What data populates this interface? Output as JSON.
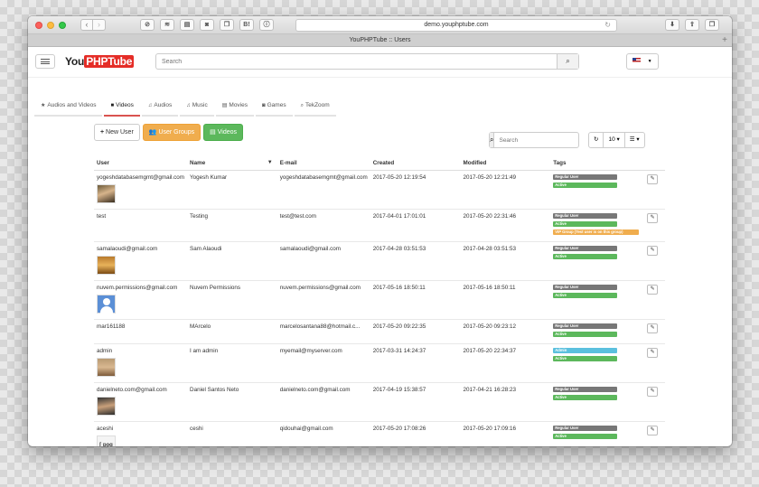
{
  "browser": {
    "url": "demo.youphptube.com",
    "tab_title": "YouPHPTube :: Users",
    "toolbar_icons": [
      "block-icon",
      "layers-icon",
      "window-icon",
      "camera-icon",
      "copy-icon",
      "bi-icon",
      "info-icon"
    ],
    "bi_label": "B!"
  },
  "header": {
    "logo_you": "You",
    "logo_php": "PHPTube",
    "search_placeholder": "Search"
  },
  "categories": [
    {
      "label": "Audios and Videos",
      "icon": "star-icon",
      "glyph": "★"
    },
    {
      "label": "Videos",
      "icon": "video-icon",
      "glyph": "■"
    },
    {
      "label": "Audios",
      "icon": "headphones-icon",
      "glyph": "♫"
    },
    {
      "label": "Music",
      "icon": "headphones-icon",
      "glyph": "♫"
    },
    {
      "label": "Movies",
      "icon": "film-icon",
      "glyph": "▤"
    },
    {
      "label": "Games",
      "icon": "gamepad-icon",
      "glyph": "◙"
    },
    {
      "label": "TekZoom",
      "icon": "zoom-icon",
      "glyph": "⌕"
    }
  ],
  "actions": {
    "new_user": "New User",
    "user_groups": "User Groups",
    "videos": "Videos"
  },
  "table_controls": {
    "search_placeholder": "Search",
    "page_size": "10"
  },
  "table": {
    "headers": [
      "User",
      "Name",
      "E-mail",
      "Created",
      "Modified",
      "Tags"
    ],
    "rows": [
      {
        "user": "yogeshdatabasemgmt@gmail.com",
        "name": "Yogesh Kumar",
        "email": "yogeshdatabasemgmt@gmail.com",
        "created": "2017-05-20 12:19:54",
        "modified": "2017-05-20 12:21:49",
        "tags": [
          "Regular User",
          "Active"
        ]
      },
      {
        "user": "test",
        "name": "Testing",
        "email": "test@test.com",
        "created": "2017-04-01 17:01:01",
        "modified": "2017-05-20 22:31:46",
        "tags": [
          "Regular User",
          "Active",
          "VIP Group (Test user is on this group)"
        ]
      },
      {
        "user": "samalaoudi@gmail.com",
        "name": "Sam Alaoudi",
        "email": "samalaoudi@gmail.com",
        "created": "2017-04-28 03:51:53",
        "modified": "2017-04-28 03:51:53",
        "tags": [
          "Regular User",
          "Active"
        ]
      },
      {
        "user": "nuvem.permissions@gmail.com",
        "name": "Nuvem Permissions",
        "email": "nuvem.permissions@gmail.com",
        "created": "2017-05-16 18:50:11",
        "modified": "2017-05-16 18:50:11",
        "tags": [
          "Regular User",
          "Active"
        ]
      },
      {
        "user": "mar161188",
        "name": "MArcelo",
        "email": "marcelosantana88@hotmail.c...",
        "created": "2017-05-20 09:22:35",
        "modified": "2017-05-20 09:23:12",
        "tags": [
          "Regular User",
          "Active"
        ]
      },
      {
        "user": "admin",
        "name": "I am admin",
        "email": "myemail@myserver.com",
        "created": "2017-03-31 14:24:37",
        "modified": "2017-05-20 22:34:37",
        "tags": [
          "Admin",
          "Active"
        ]
      },
      {
        "user": "danielneto.com@gmail.com",
        "name": "Daniel Santos Neto",
        "email": "danielneto.com@gmail.com",
        "created": "2017-04-19 15:38:57",
        "modified": "2017-04-21 16:28:23",
        "tags": [
          "Regular User",
          "Active"
        ]
      },
      {
        "user": "aceshi",
        "name": "ceshi",
        "email": "qidouhai@gmail.com",
        "created": "2017-05-20 17:08:26",
        "modified": "2017-05-20 17:09:16",
        "tags": [
          "Regular User",
          "Active"
        ]
      }
    ]
  },
  "colors": {
    "brand_red": "#e52d27",
    "active_tab": "#d9534f",
    "tag_regular": "#777777",
    "tag_active": "#5cb85c",
    "tag_admin": "#5bc0de",
    "tag_vip": "#f0ad4e"
  }
}
